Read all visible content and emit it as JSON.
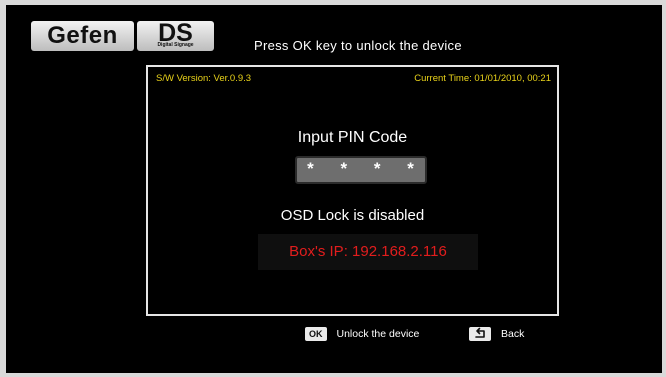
{
  "header": {
    "logo_primary": "Gefen",
    "logo_secondary": "DS",
    "logo_tagline": "Digital Signage",
    "message": "Press OK key to unlock the device"
  },
  "panel": {
    "sw_version": "S/W Version: Ver.0.9.3",
    "current_time": "Current Time: 01/01/2010, 00:21",
    "pin_label": "Input PIN Code",
    "pin_value": "* * * *",
    "osd_status": "OSD Lock is disabled",
    "ip_text": "Box's IP: 192.168.2.116"
  },
  "footer": {
    "ok_key": "OK",
    "ok_label": "Unlock the device",
    "back_label": "Back"
  },
  "colors": {
    "background": "#000000",
    "info_text": "#e8d21a",
    "ip_text": "#e21d1d",
    "pin_field": "#6e6e6e"
  }
}
